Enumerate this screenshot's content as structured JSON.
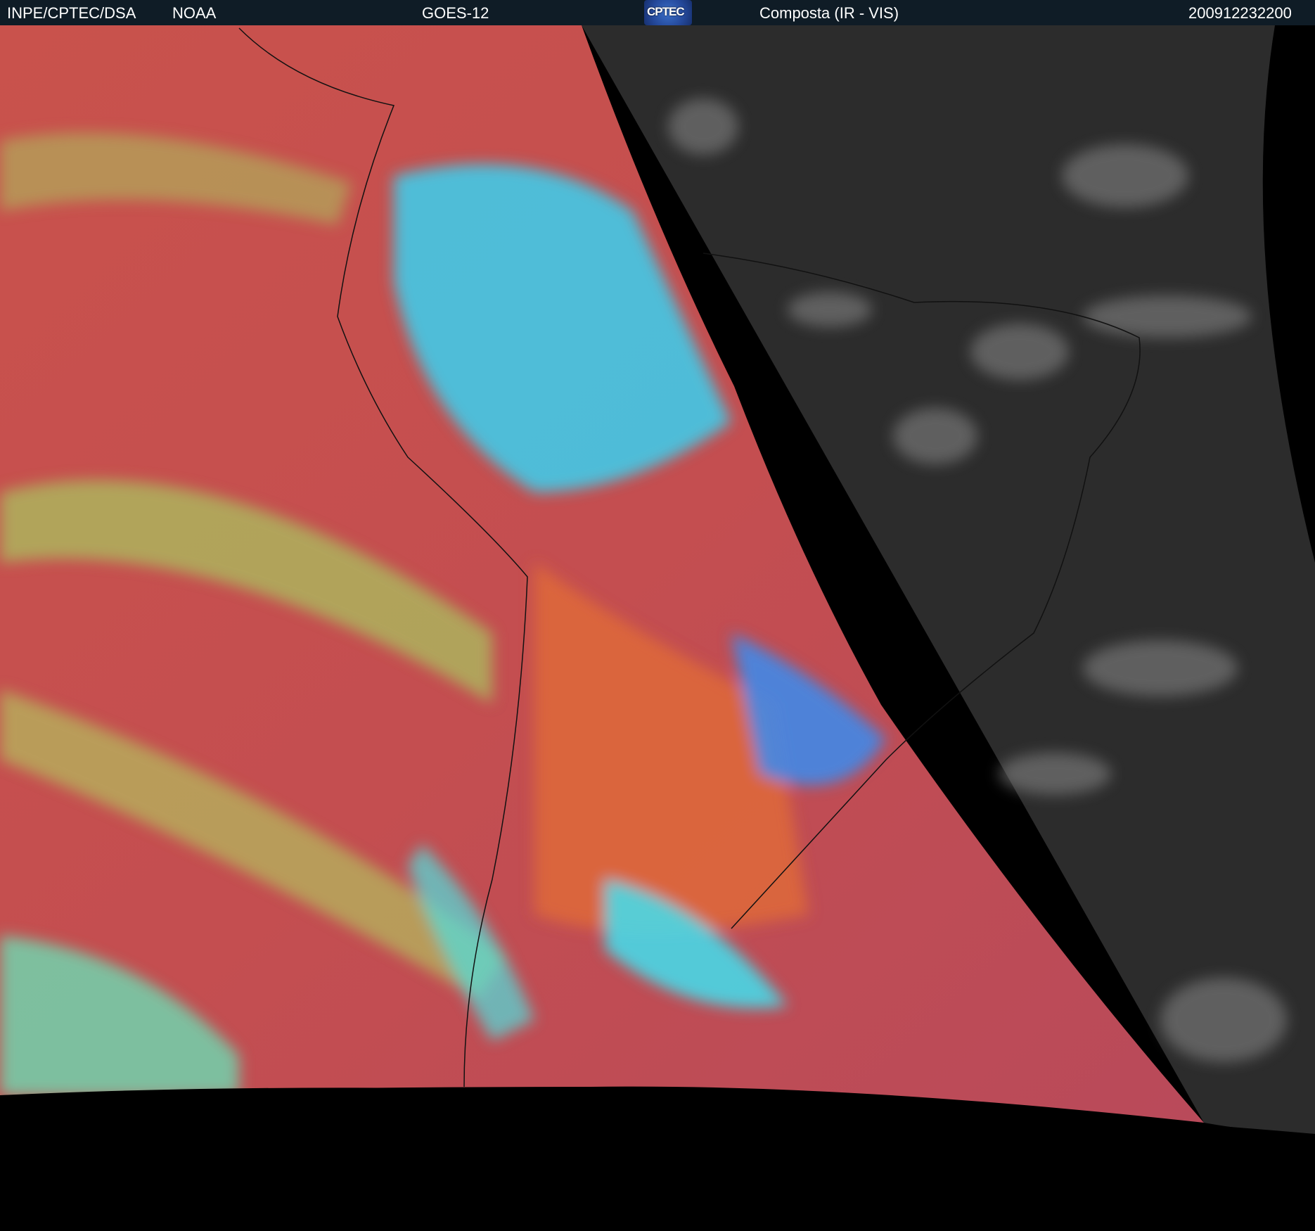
{
  "header": {
    "agency": "INPE/CPTEC/DSA",
    "source": "NOAA",
    "satellite": "GOES-12",
    "logo_text": "CPTEC",
    "product": "Composta (IR - VIS)",
    "timestamp": "200912232200"
  },
  "colors": {
    "header_bg": "#0f1c26",
    "ir_warm": "#c8504a",
    "ir_cloud": "#30d8f0",
    "vis_bg": "#2e2e2e"
  }
}
